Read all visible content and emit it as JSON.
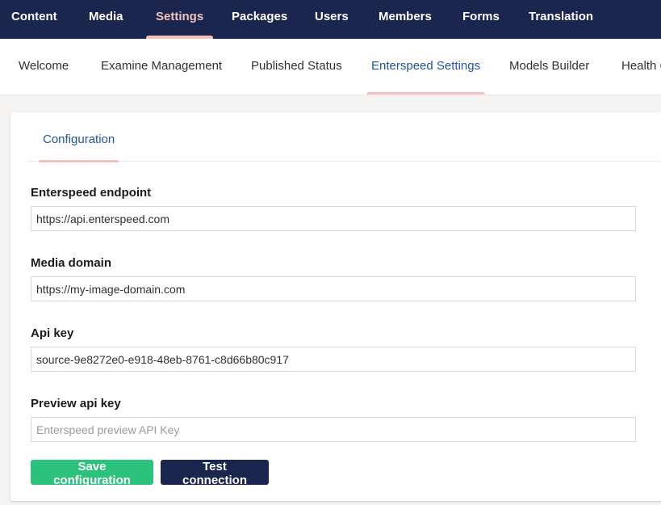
{
  "topnav": {
    "items": [
      {
        "label": "Content"
      },
      {
        "label": "Media"
      },
      {
        "label": "Settings"
      },
      {
        "label": "Packages"
      },
      {
        "label": "Users"
      },
      {
        "label": "Members"
      },
      {
        "label": "Forms"
      },
      {
        "label": "Translation"
      }
    ],
    "active": "Settings"
  },
  "subnav": {
    "items": [
      {
        "label": "Welcome"
      },
      {
        "label": "Examine Management"
      },
      {
        "label": "Published Status"
      },
      {
        "label": "Enterspeed Settings"
      },
      {
        "label": "Models Builder"
      },
      {
        "label": "Health Check"
      }
    ],
    "active": "Enterspeed Settings"
  },
  "tabs": {
    "configuration_label": "Configuration"
  },
  "form": {
    "endpoint": {
      "label": "Enterspeed endpoint",
      "value": "https://api.enterspeed.com"
    },
    "media_domain": {
      "label": "Media domain",
      "value": "https://my-image-domain.com"
    },
    "api_key": {
      "label": "Api key",
      "value": "source-9e8272e0-e918-48eb-8761-c8d66b80c917"
    },
    "preview_api_key": {
      "label": "Preview api key",
      "value": "",
      "placeholder": "Enterspeed preview API Key"
    }
  },
  "actions": {
    "save_label": "Save configuration",
    "test_label": "Test connection"
  },
  "colors": {
    "header_bg": "#1b264f",
    "active_accent": "#f5c1bc",
    "link_blue": "#2152a3",
    "save_green": "#2bc37c"
  }
}
